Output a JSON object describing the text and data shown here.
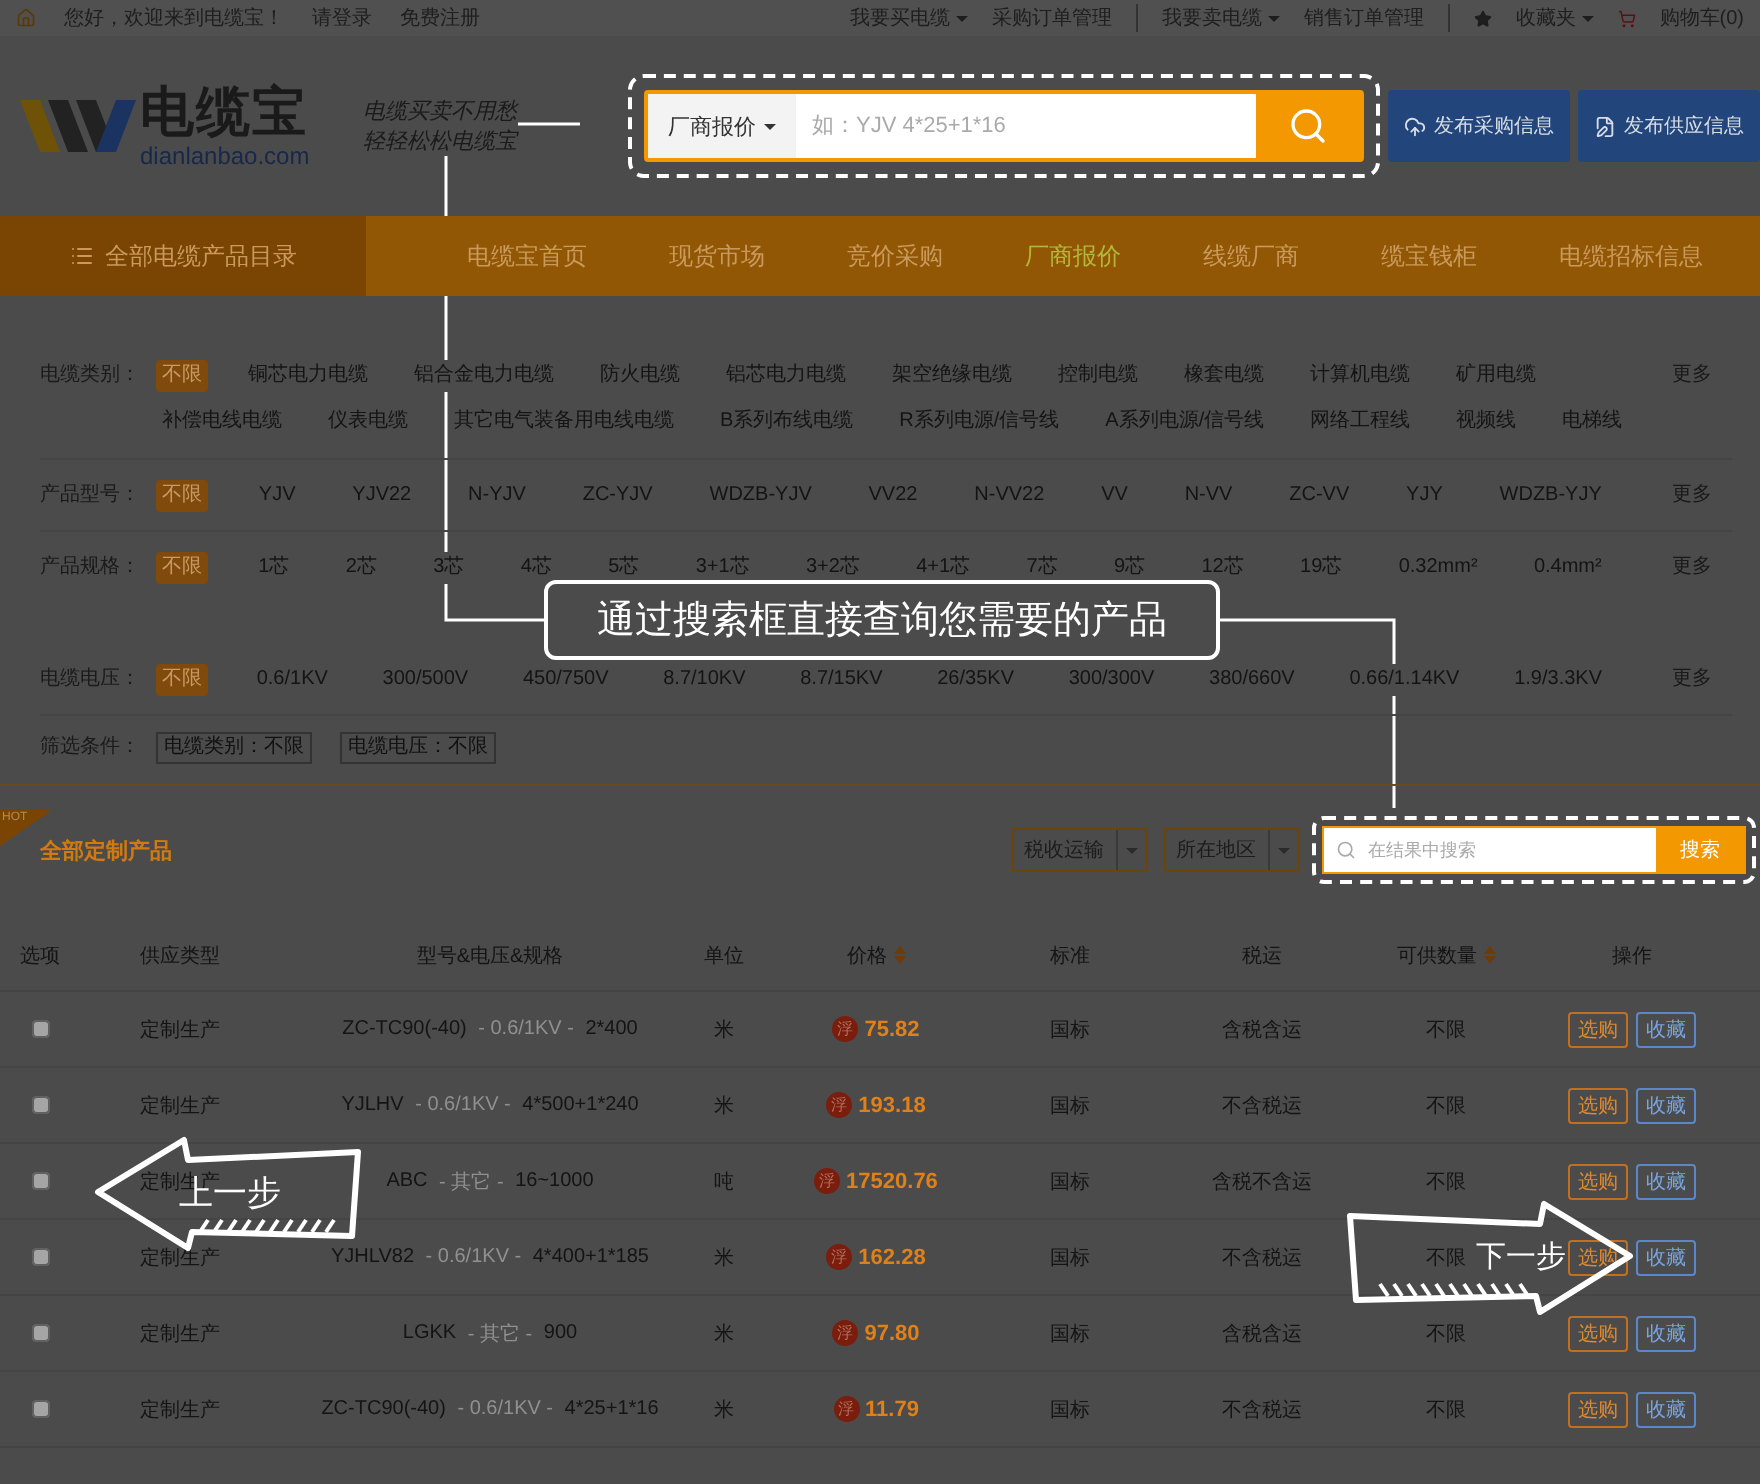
{
  "top_bar": {
    "greeting": "您好，欢迎来到电缆宝！",
    "links": [
      "请登录",
      "免费注册"
    ],
    "menus": [
      {
        "label": "我要买电缆",
        "kind": "link",
        "caret": true,
        "divider_after": false
      },
      {
        "label": "采购订单管理",
        "kind": "link",
        "caret": false,
        "divider_after": true
      },
      {
        "label": "我要卖电缆",
        "kind": "link",
        "caret": true,
        "divider_after": false
      },
      {
        "label": "销售订单管理",
        "kind": "link",
        "caret": false,
        "divider_after": true
      },
      {
        "label": "收藏夹",
        "kind": "favorites",
        "caret": true,
        "divider_after": false
      },
      {
        "label": "购物车(0)",
        "kind": "cart",
        "caret": false,
        "divider_after": false
      }
    ]
  },
  "header": {
    "logo": {
      "name": "电缆宝",
      "domain": "dianlanbao.com"
    },
    "slogan": [
      "电缆买卖不用愁",
      "轻轻松松电缆宝"
    ],
    "search": {
      "category": "厂商报价",
      "placeholder": "如：YJV 4*25+1*16"
    },
    "buttons": [
      "发布采购信息",
      "发布供应信息"
    ]
  },
  "nav": {
    "catalog": "全部电缆产品目录",
    "items": [
      {
        "label": "电缆宝首页",
        "selected": false
      },
      {
        "label": "现货市场",
        "selected": false
      },
      {
        "label": "竞价采购",
        "selected": false
      },
      {
        "label": "厂商报价",
        "selected": true
      },
      {
        "label": "线缆厂商",
        "selected": false
      },
      {
        "label": "缆宝钱柜",
        "selected": false
      },
      {
        "label": "电缆招标信息",
        "selected": false
      }
    ]
  },
  "filters": [
    {
      "label": "电缆类别：",
      "more": "更多",
      "options": [
        {
          "label": "不限",
          "selected": true
        },
        {
          "label": "铜芯电力电缆",
          "selected": false
        },
        {
          "label": "铝合金电力电缆",
          "selected": false
        },
        {
          "label": "防火电缆",
          "selected": false
        },
        {
          "label": "铝芯电力电缆",
          "selected": false
        },
        {
          "label": "架空绝缘电缆",
          "selected": false
        },
        {
          "label": "控制电缆",
          "selected": false
        },
        {
          "label": "橡套电缆",
          "selected": false
        },
        {
          "label": "计算机电缆",
          "selected": false
        },
        {
          "label": "矿用电缆",
          "selected": false
        },
        {
          "label": "补偿电线电缆",
          "selected": false
        },
        {
          "label": "仪表电缆",
          "selected": false
        },
        {
          "label": "其它电气装备用电线电缆",
          "selected": false
        },
        {
          "label": "B系列布线电缆",
          "selected": false
        },
        {
          "label": "R系列电源/信号线",
          "selected": false
        },
        {
          "label": "A系列电源/信号线",
          "selected": false
        },
        {
          "label": "网络工程线",
          "selected": false
        },
        {
          "label": "视频线",
          "selected": false
        },
        {
          "label": "电梯线",
          "selected": false
        }
      ]
    },
    {
      "label": "产品型号：",
      "more": "更多",
      "options": [
        {
          "label": "不限",
          "selected": true
        },
        {
          "label": "YJV",
          "selected": false
        },
        {
          "label": "YJV22",
          "selected": false
        },
        {
          "label": "N-YJV",
          "selected": false
        },
        {
          "label": "ZC-YJV",
          "selected": false
        },
        {
          "label": "WDZB-YJV",
          "selected": false
        },
        {
          "label": "VV22",
          "selected": false
        },
        {
          "label": "N-VV22",
          "selected": false
        },
        {
          "label": "VV",
          "selected": false
        },
        {
          "label": "N-VV",
          "selected": false
        },
        {
          "label": "ZC-VV",
          "selected": false
        },
        {
          "label": "YJY",
          "selected": false
        },
        {
          "label": "WDZB-YJY",
          "selected": false
        }
      ]
    },
    {
      "label": "产品规格：",
      "more": "更多",
      "options": [
        {
          "label": "不限",
          "selected": true
        },
        {
          "label": "1芯",
          "selected": false
        },
        {
          "label": "2芯",
          "selected": false
        },
        {
          "label": "3芯",
          "selected": false
        },
        {
          "label": "4芯",
          "selected": false
        },
        {
          "label": "5芯",
          "selected": false
        },
        {
          "label": "3+1芯",
          "selected": false
        },
        {
          "label": "3+2芯",
          "selected": false
        },
        {
          "label": "4+1芯",
          "selected": false
        },
        {
          "label": "7芯",
          "selected": false
        },
        {
          "label": "9芯",
          "selected": false
        },
        {
          "label": "12芯",
          "selected": false
        },
        {
          "label": "19芯",
          "selected": false
        },
        {
          "label": "0.32mm²",
          "selected": false
        },
        {
          "label": "0.4mm²",
          "selected": false
        }
      ]
    },
    {
      "label": "电缆电压：",
      "more": "更多",
      "options": [
        {
          "label": "不限",
          "selected": true
        },
        {
          "label": "0.6/1KV",
          "selected": false
        },
        {
          "label": "300/500V",
          "selected": false
        },
        {
          "label": "450/750V",
          "selected": false
        },
        {
          "label": "8.7/10KV",
          "selected": false
        },
        {
          "label": "8.7/15KV",
          "selected": false
        },
        {
          "label": "26/35KV",
          "selected": false
        },
        {
          "label": "300/300V",
          "selected": false
        },
        {
          "label": "380/660V",
          "selected": false
        },
        {
          "label": "0.66/1.14KV",
          "selected": false
        },
        {
          "label": "1.9/3.3KV",
          "selected": false
        }
      ]
    }
  ],
  "conditions": {
    "label": "筛选条件：",
    "chips": [
      "电缆类别：不限",
      "电缆电压：不限"
    ]
  },
  "results": {
    "badge": "HOT",
    "title": "全部定制产品",
    "selects": [
      "税收运输",
      "所在地区"
    ],
    "search": {
      "placeholder": "在结果中搜索",
      "button": "搜索"
    }
  },
  "table": {
    "columns": [
      {
        "label": "选项",
        "sortable": false
      },
      {
        "label": "供应类型",
        "sortable": false
      },
      {
        "label": "型号&电压&规格",
        "sortable": false
      },
      {
        "label": "单位",
        "sortable": false
      },
      {
        "label": "价格",
        "sortable": true
      },
      {
        "label": "标准",
        "sortable": false
      },
      {
        "label": "税运",
        "sortable": false
      },
      {
        "label": "可供数量",
        "sortable": true
      },
      {
        "label": "操作",
        "sortable": false
      }
    ],
    "rows": [
      {
        "checked": false,
        "type": "定制生产",
        "model_parts": [
          "ZC-TC90(-40)",
          " - 0.6/1KV - ",
          "2*400"
        ],
        "unit": "米",
        "price_tag": "浮",
        "price": "75.82",
        "standard": "国标",
        "tax": "含税含运",
        "qty": "不限",
        "actions": [
          "选购",
          "收藏"
        ]
      },
      {
        "checked": false,
        "type": "定制生产",
        "model_parts": [
          "YJLHV",
          " - 0.6/1KV - ",
          "4*500+1*240"
        ],
        "unit": "米",
        "price_tag": "浮",
        "price": "193.18",
        "standard": "国标",
        "tax": "不含税运",
        "qty": "不限",
        "actions": [
          "选购",
          "收藏"
        ]
      },
      {
        "checked": false,
        "type": "定制生产",
        "model_parts": [
          "ABC",
          " - 其它 - ",
          "16~1000"
        ],
        "unit": "吨",
        "price_tag": "浮",
        "price": "17520.76",
        "standard": "国标",
        "tax": "含税不含运",
        "qty": "不限",
        "actions": [
          "选购",
          "收藏"
        ]
      },
      {
        "checked": false,
        "type": "定制生产",
        "model_parts": [
          "YJHLV82",
          " - 0.6/1KV - ",
          "4*400+1*185"
        ],
        "unit": "米",
        "price_tag": "浮",
        "price": "162.28",
        "standard": "国标",
        "tax": "不含税运",
        "qty": "不限",
        "actions": [
          "选购",
          "收藏"
        ]
      },
      {
        "checked": false,
        "type": "定制生产",
        "model_parts": [
          "LGKK",
          " - 其它 - ",
          "900"
        ],
        "unit": "米",
        "price_tag": "浮",
        "price": "97.80",
        "standard": "国标",
        "tax": "含税含运",
        "qty": "不限",
        "actions": [
          "选购",
          "收藏"
        ]
      },
      {
        "checked": false,
        "type": "定制生产",
        "model_parts": [
          "ZC-TC90(-40)",
          " - 0.6/1KV - ",
          "4*25+1*16"
        ],
        "unit": "米",
        "price_tag": "浮",
        "price": "11.79",
        "standard": "国标",
        "tax": "不含税运",
        "qty": "不限",
        "actions": [
          "选购",
          "收藏"
        ]
      }
    ]
  },
  "tour": {
    "message": "通过搜索框直接查询您需要的产品",
    "prev": "上一步",
    "next": "下一步"
  }
}
